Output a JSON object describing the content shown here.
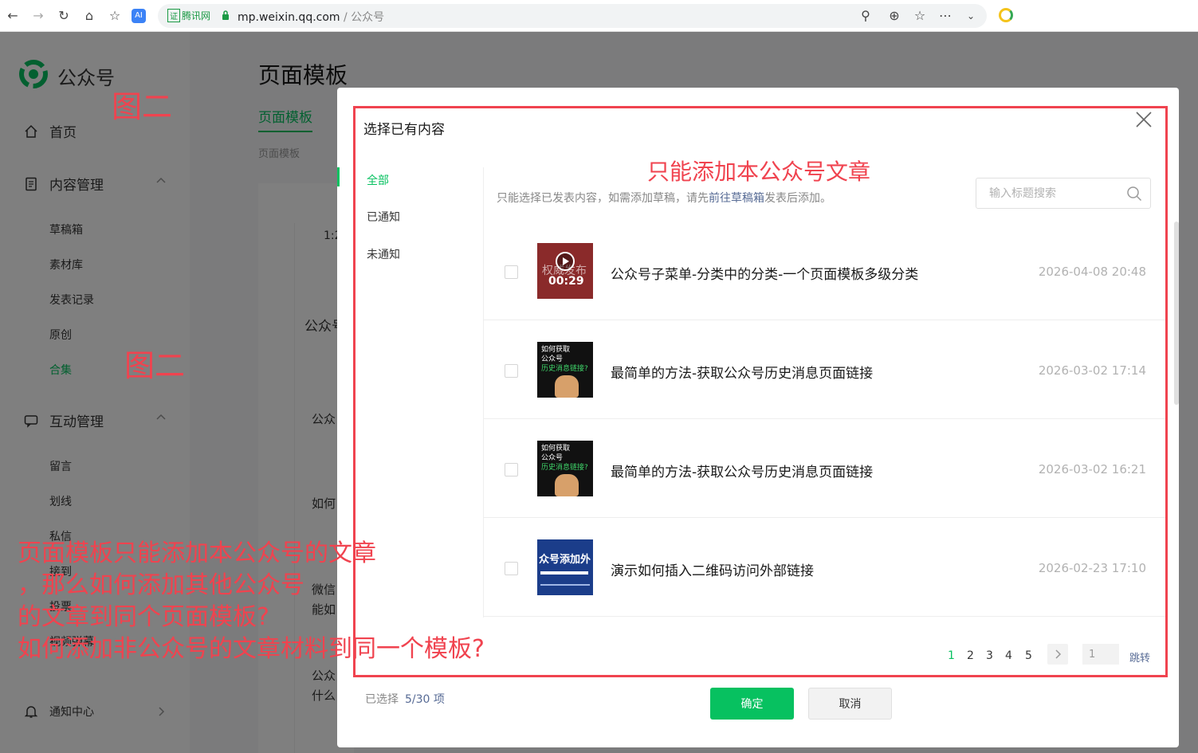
{
  "browser": {
    "cert_badge": "证",
    "cert_label": "腾讯网",
    "url_host": "mp.weixin.qq.com",
    "url_path": " / 公众号"
  },
  "sidebar": {
    "logo_text": "公众号",
    "home": "首页",
    "content_mgmt": "内容管理",
    "content_items": [
      "草稿箱",
      "素材库",
      "发表记录",
      "原创",
      "合集"
    ],
    "interaction_mgmt": "互动管理",
    "interaction_items": [
      "留言",
      "划线",
      "私信",
      "接到",
      "投票",
      "视频弹幕"
    ],
    "notify": "通知中心"
  },
  "main": {
    "page_title": "页面模板",
    "tab": "页面模板",
    "crumb": "页面模板",
    "bg_texts": [
      "1:2",
      "公众号",
      "公众",
      "如何",
      "微信",
      "能如",
      "公众",
      "什么"
    ]
  },
  "modal": {
    "title": "选择已有内容",
    "filters": [
      "全部",
      "已通知",
      "未通知"
    ],
    "notice_pre": "只能选择已发表内容，如需添加草稿，请先",
    "notice_link": "前往草稿箱",
    "notice_post": "发表后添加。",
    "search_placeholder": "输入标题搜索",
    "rows": [
      {
        "title": "公众号子菜单-分类中的分类-一个页面模板多级分类",
        "date": "2026-04-08 20:48",
        "thumb_text": "权威发布",
        "thumb_time": "00:29"
      },
      {
        "title": "最简单的方法-获取公众号历史消息页面链接",
        "date": "2026-03-02 17:14",
        "thumb_line1": "如何获取",
        "thumb_line2": "公众号",
        "thumb_line3": "历史消息链接?"
      },
      {
        "title": "最简单的方法-获取公众号历史消息页面链接",
        "date": "2026-03-02 16:21",
        "thumb_line1": "如何获取",
        "thumb_line2": "公众号",
        "thumb_line3": "历史消息链接?"
      },
      {
        "title": "演示如何插入二维码访问外部链接",
        "date": "2026-02-23 17:10",
        "thumb_text": "众号添加外"
      }
    ],
    "pages": [
      "1",
      "2",
      "3",
      "4",
      "5"
    ],
    "page_input": "1",
    "jump": "跳转",
    "selected_label": "已选择",
    "selected_value": "5/30 项",
    "ok": "确定",
    "cancel": "取消"
  },
  "annotations": {
    "fig_label_top": "图二",
    "fig_label_mid": "图二",
    "modal_note": "只能添加本公众号文章",
    "question_lines": [
      "页面模板只能添加本公众号的文章",
      "，那么如何添加其他公众号",
      "的文章到同个页面模板?",
      "如何添加非公众号的文章材料到同一个模板?"
    ]
  },
  "colors": {
    "accent": "#07c160",
    "link": "#576b95",
    "annotation": "#f0434f"
  }
}
